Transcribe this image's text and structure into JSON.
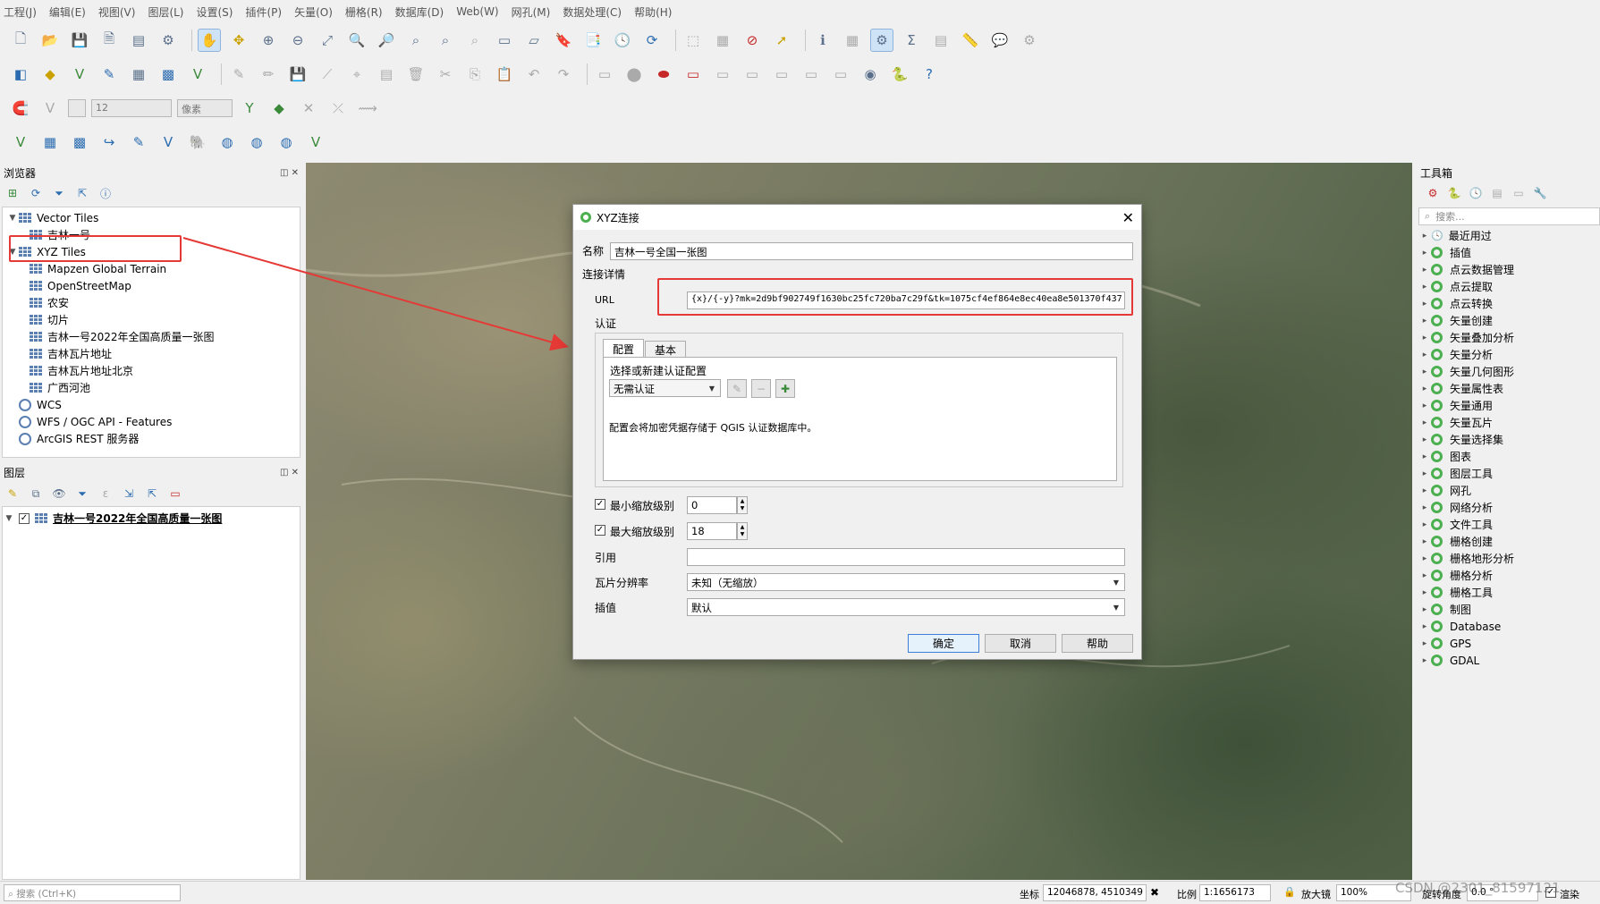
{
  "menu": [
    "工程(J)",
    "编辑(E)",
    "视图(V)",
    "图层(L)",
    "设置(S)",
    "插件(P)",
    "矢量(O)",
    "栅格(R)",
    "数据库(D)",
    "Web(W)",
    "网孔(M)",
    "数据处理(C)",
    "帮助(H)"
  ],
  "digitizing": {
    "size_value": "12",
    "unit": "像素"
  },
  "browser": {
    "title": "浏览器",
    "items": [
      {
        "label": "Vector Tiles",
        "indent": 0,
        "arrow": "down",
        "icon": "grid"
      },
      {
        "label": "吉林一号",
        "indent": 1,
        "arrow": "",
        "icon": "grid"
      },
      {
        "label": "XYZ Tiles",
        "indent": 0,
        "arrow": "down",
        "icon": "grid"
      },
      {
        "label": "Mapzen Global Terrain",
        "indent": 1,
        "arrow": "",
        "icon": "grid"
      },
      {
        "label": "OpenStreetMap",
        "indent": 1,
        "arrow": "",
        "icon": "grid"
      },
      {
        "label": "农安",
        "indent": 1,
        "arrow": "",
        "icon": "grid"
      },
      {
        "label": "切片",
        "indent": 1,
        "arrow": "",
        "icon": "grid"
      },
      {
        "label": "吉林一号2022年全国高质量一张图",
        "indent": 1,
        "arrow": "",
        "icon": "grid"
      },
      {
        "label": "吉林瓦片地址",
        "indent": 1,
        "arrow": "",
        "icon": "grid"
      },
      {
        "label": "吉林瓦片地址北京",
        "indent": 1,
        "arrow": "",
        "icon": "grid"
      },
      {
        "label": "广西河池",
        "indent": 1,
        "arrow": "",
        "icon": "grid"
      },
      {
        "label": "WCS",
        "indent": 0,
        "arrow": "",
        "icon": "globe"
      },
      {
        "label": "WFS / OGC API - Features",
        "indent": 0,
        "arrow": "",
        "icon": "globe"
      },
      {
        "label": "ArcGIS REST 服务器",
        "indent": 0,
        "arrow": "",
        "icon": "globe"
      }
    ]
  },
  "layers": {
    "title": "图层",
    "layer_name": "吉林一号2022年全国高质量一张图"
  },
  "toolbox": {
    "title": "工具箱",
    "search_placeholder": "搜索...",
    "items": [
      "最近用过",
      "插值",
      "点云数据管理",
      "点云提取",
      "点云转换",
      "矢量创建",
      "矢量叠加分析",
      "矢量分析",
      "矢量几何图形",
      "矢量属性表",
      "矢量通用",
      "矢量瓦片",
      "矢量选择集",
      "图表",
      "图层工具",
      "网孔",
      "网络分析",
      "文件工具",
      "栅格创建",
      "栅格地形分析",
      "栅格分析",
      "栅格工具",
      "制图",
      "Database",
      "GPS",
      "GDAL"
    ]
  },
  "dialog": {
    "title": "XYZ连接",
    "name_label": "名称",
    "name_value": "吉林一号全国一张图",
    "connection_details": "连接详情",
    "url_label": "URL",
    "url_value": "{x}/{-y}?mk=2d9bf902749f1630bc25fc720ba7c29f&tk=1075cf4ef864e8ec40ea8e501370f437",
    "auth_label": "认证",
    "tab_config": "配置",
    "tab_basic": "基本",
    "auth_select_label": "选择或新建认证配置",
    "auth_select_value": "无需认证",
    "auth_note": "配置会将加密凭据存储于 QGIS 认证数据库中。",
    "min_zoom_label": "最小缩放级别",
    "min_zoom_value": "0",
    "max_zoom_label": "最大缩放级别",
    "max_zoom_value": "18",
    "referer_label": "引用",
    "referer_value": "",
    "tile_res_label": "瓦片分辨率",
    "tile_res_value": "未知（无缩放）",
    "interp_label": "插值",
    "interp_value": "默认",
    "ok": "确定",
    "cancel": "取消",
    "help": "帮助"
  },
  "statusbar": {
    "search_placeholder": "搜索 (Ctrl+K)",
    "coord_label": "坐标",
    "coord_value": "12046878, 4510349",
    "scale_label": "比例",
    "scale_value": "1:1656173",
    "magnifier_label": "放大镜",
    "magnifier_value": "100%",
    "rotation_label": "旋转角度",
    "rotation_value": "0.0 °",
    "render_label": "渲染"
  },
  "watermark": "CSDN @2301_81597121",
  "colors": {
    "highlight_red": "#e53935",
    "qgis_green": "#4caf50",
    "accent_blue": "#3c7fd8"
  }
}
